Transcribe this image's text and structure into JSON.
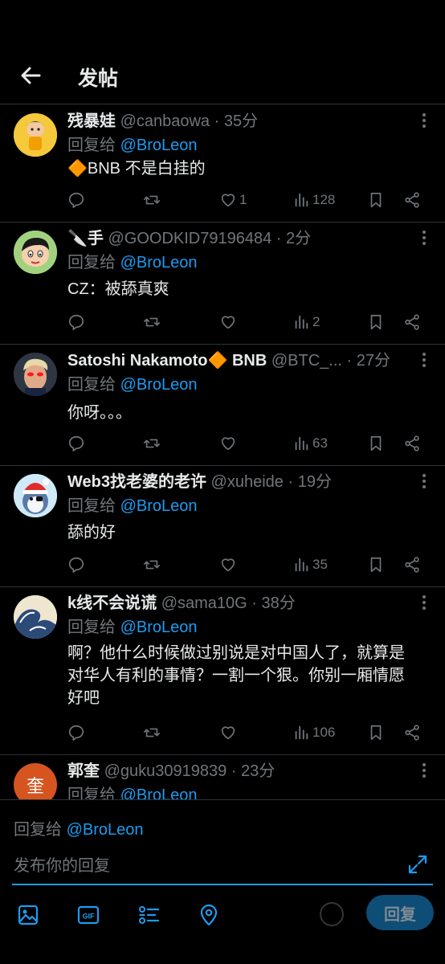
{
  "header": {
    "title": "发帖"
  },
  "posts": [
    {
      "name": "残暴娃",
      "handle": "@canbaowa",
      "time": "· 35分",
      "reply_label": "回复给",
      "reply_to": "@BroLeon",
      "text": "🔶BNB 不是白挂的",
      "likes": "1",
      "views": "128"
    },
    {
      "name": "🔪手",
      "handle": "@GOODKID79196484",
      "time": "· 2分",
      "reply_label": "回复给",
      "reply_to": "@BroLeon",
      "text": "CZ：被舔真爽",
      "likes": "",
      "views": "2"
    },
    {
      "name": "Satoshi Nakamoto🔶 BNB",
      "handle": "@BTC_...",
      "time": "· 27分",
      "reply_label": "回复给",
      "reply_to": "@BroLeon",
      "text": "你呀。。。",
      "likes": "",
      "views": "63"
    },
    {
      "name": "Web3找老婆的老许",
      "handle": "@xuheide",
      "time": "· 19分",
      "reply_label": "回复给",
      "reply_to": "@BroLeon",
      "text": "舔的好",
      "likes": "",
      "views": "35"
    },
    {
      "name": "k线不会说谎",
      "handle": "@sama10G",
      "time": "· 38分",
      "reply_label": "回复给",
      "reply_to": "@BroLeon",
      "text_lines": [
        "啊？他什么时候做过别说是对中国人了，就算是",
        "对华人有利的事情？一割一个狠。你别一厢情愿",
        "好吧"
      ],
      "likes": "",
      "views": "106"
    },
    {
      "name": "郭奎",
      "handle": "@guku30919839",
      "time": "· 23分",
      "reply_label": "回复给",
      "reply_to": "@BroLeon",
      "avatar_char": "奎"
    }
  ],
  "composer": {
    "reply_label": "回复给",
    "reply_to": "@BroLeon",
    "placeholder": "发布你的回复",
    "reply_button": "回复"
  },
  "colors": {
    "accent": "#1d9bf0",
    "muted": "#71767b",
    "background": "#000000",
    "divider": "#2f3336"
  }
}
